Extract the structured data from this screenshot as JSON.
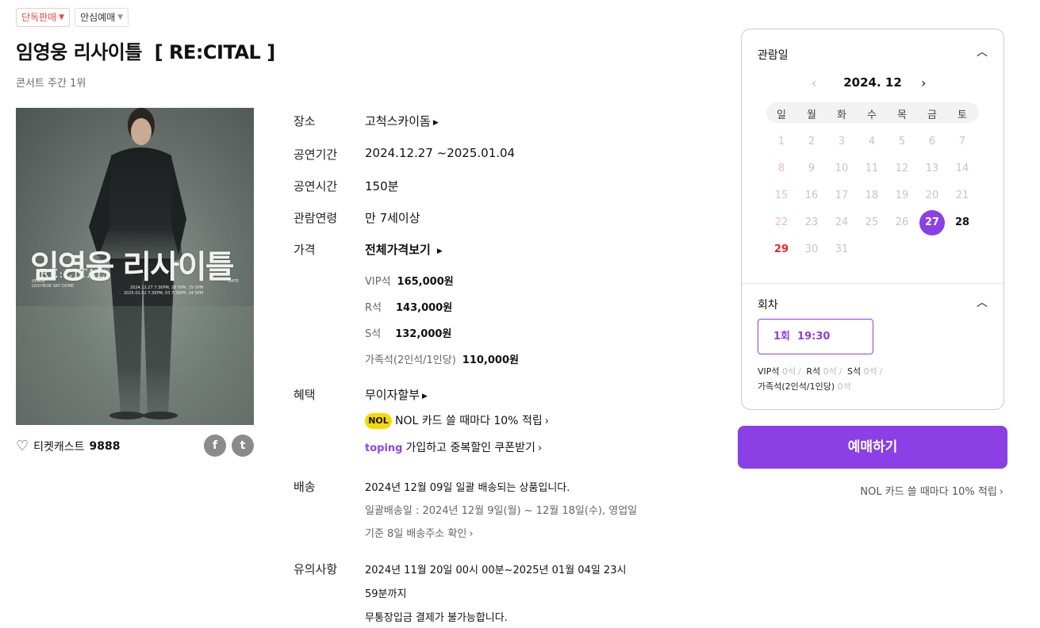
{
  "badges": [
    "단독판매",
    "안심예매"
  ],
  "title": "임영웅 리사이틀  [ RE:CITAL ]",
  "rank": "콘서트 주간 1위",
  "poster": {
    "title": "임영웅 리사이틀",
    "subtitle": "RE:CITAL",
    "venue": "GOCHEOK SKY DOME",
    "dates1": "2024.12.27 7:30PM, 28 5PM, 29 5PM",
    "dates2": "2025.01.02 7:30PM, 03 7:30PM, 04 5PM",
    "date_label": "DATE",
    "venue_label": "VENUE"
  },
  "wish": {
    "label": "티켓캐스트",
    "count": "9888"
  },
  "share": {
    "facebook": "f",
    "twitter": "t"
  },
  "info": {
    "venue_label": "장소",
    "venue": "고척스카이돔",
    "period_label": "공연기간",
    "period": "2024.12.27 ~2025.01.04",
    "runtime_label": "공연시간",
    "runtime": "150분",
    "age_label": "관람연령",
    "age": "만 7세이상",
    "price_label": "가격",
    "price_all": "전체가격보기",
    "prices": [
      {
        "name": "VIP석",
        "value": "165,000원"
      },
      {
        "name": "R석",
        "value": "143,000원"
      },
      {
        "name": "S석",
        "value": "132,000원"
      },
      {
        "name": "가족석(2인석/1인당)",
        "value": "110,000원"
      }
    ],
    "benefit_label": "혜택",
    "benefit": "무이자할부",
    "nol_logo": "NOL",
    "nol_benefit": "NOL 카드 쓸 때마다 10% 적립",
    "toping_logo": "toping",
    "toping_benefit": "가입하고 중복할인 쿠폰받기",
    "delivery_label": "배송",
    "delivery": "2024년 12월 09일 일괄 배송되는 상품입니다.",
    "delivery_detail1": "일괄배송일 : 2024년 12월 9일(월) ~ 12월 18일(수), 영업일",
    "delivery_detail2": "기준 8일 배송주소 확인",
    "notice_label": "유의사항",
    "notice1": "2024년 11월 20일 00시 00분~2025년 01월 04일 23시",
    "notice2": "59분까지",
    "notice3": "무통장입금 결제가 불가능합니다."
  },
  "panel": {
    "date_title": "관람일",
    "month": "2024. 12",
    "dow": [
      "일",
      "월",
      "화",
      "수",
      "목",
      "금",
      "토"
    ],
    "weeks": [
      [
        "1",
        "2",
        "3",
        "4",
        "5",
        "6",
        "7"
      ],
      [
        "8",
        "9",
        "10",
        "11",
        "12",
        "13",
        "14"
      ],
      [
        "15",
        "16",
        "17",
        "18",
        "19",
        "20",
        "21"
      ],
      [
        "22",
        "23",
        "24",
        "25",
        "26",
        "27",
        "28"
      ],
      [
        "29",
        "30",
        "31"
      ]
    ],
    "selected_day": "27",
    "available_days": [
      "27",
      "28",
      "29"
    ],
    "round_title": "회차",
    "round": "1회  19:30",
    "seats": [
      {
        "name": "VIP석",
        "count": "0석"
      },
      {
        "name": "R석",
        "count": "0석"
      },
      {
        "name": "S석",
        "count": "0석"
      },
      {
        "name": "가족석(2인석/1인당)",
        "count": "0석"
      }
    ]
  },
  "book_button": "예매하기",
  "nol_right": "NOL 카드 쓸 때마다 10% 적립"
}
